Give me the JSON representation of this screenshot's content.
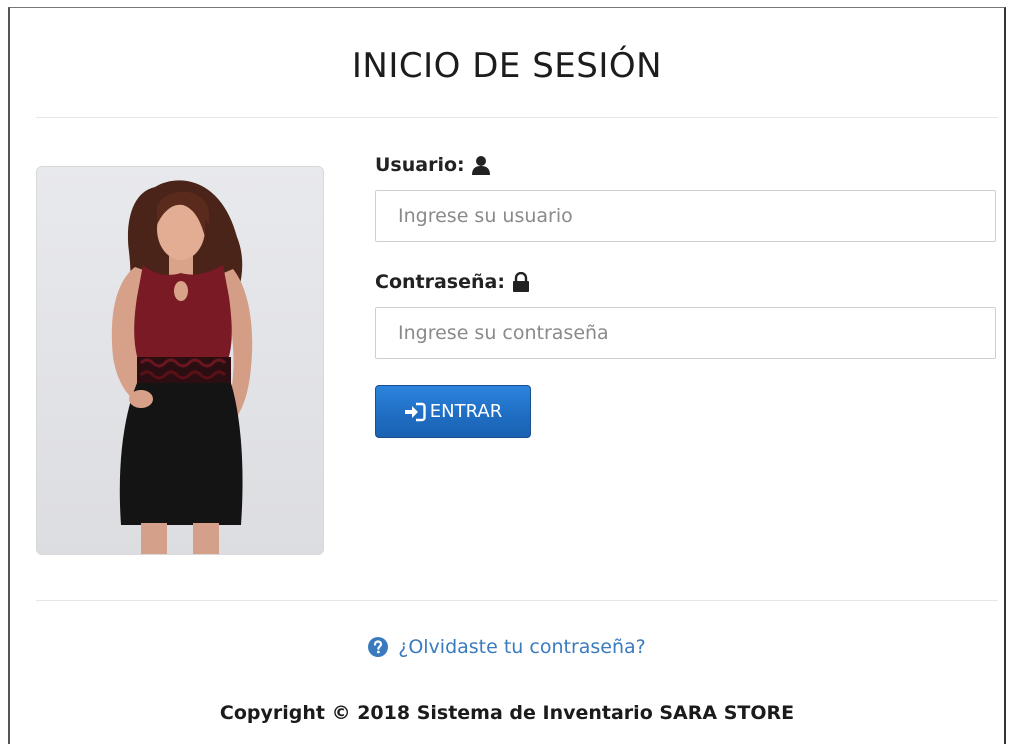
{
  "login": {
    "title": "INICIO DE SESIÓN",
    "username": {
      "label": "Usuario:",
      "icon": "user-icon",
      "placeholder": "Ingrese su usuario",
      "value": ""
    },
    "password": {
      "label": "Contraseña:",
      "icon": "lock-icon",
      "placeholder": "Ingrese su contraseña",
      "value": ""
    },
    "submit": {
      "label": "ENTRAR",
      "icon": "sign-in-icon"
    },
    "forgot_link": {
      "label": "¿Olvidaste tu contraseña?",
      "icon": "question-circle-icon"
    },
    "photo": {
      "icon": "model-photo"
    }
  },
  "footer": {
    "copyright_prefix": "Copyright © 2018",
    "copyright_name": "Sistema de Inventario SARA STORE"
  },
  "colors": {
    "button_primary": "#1f6ec4",
    "link": "#3a7bbf",
    "dress_top": "#7a1a24",
    "dress_skirt": "#141414"
  }
}
